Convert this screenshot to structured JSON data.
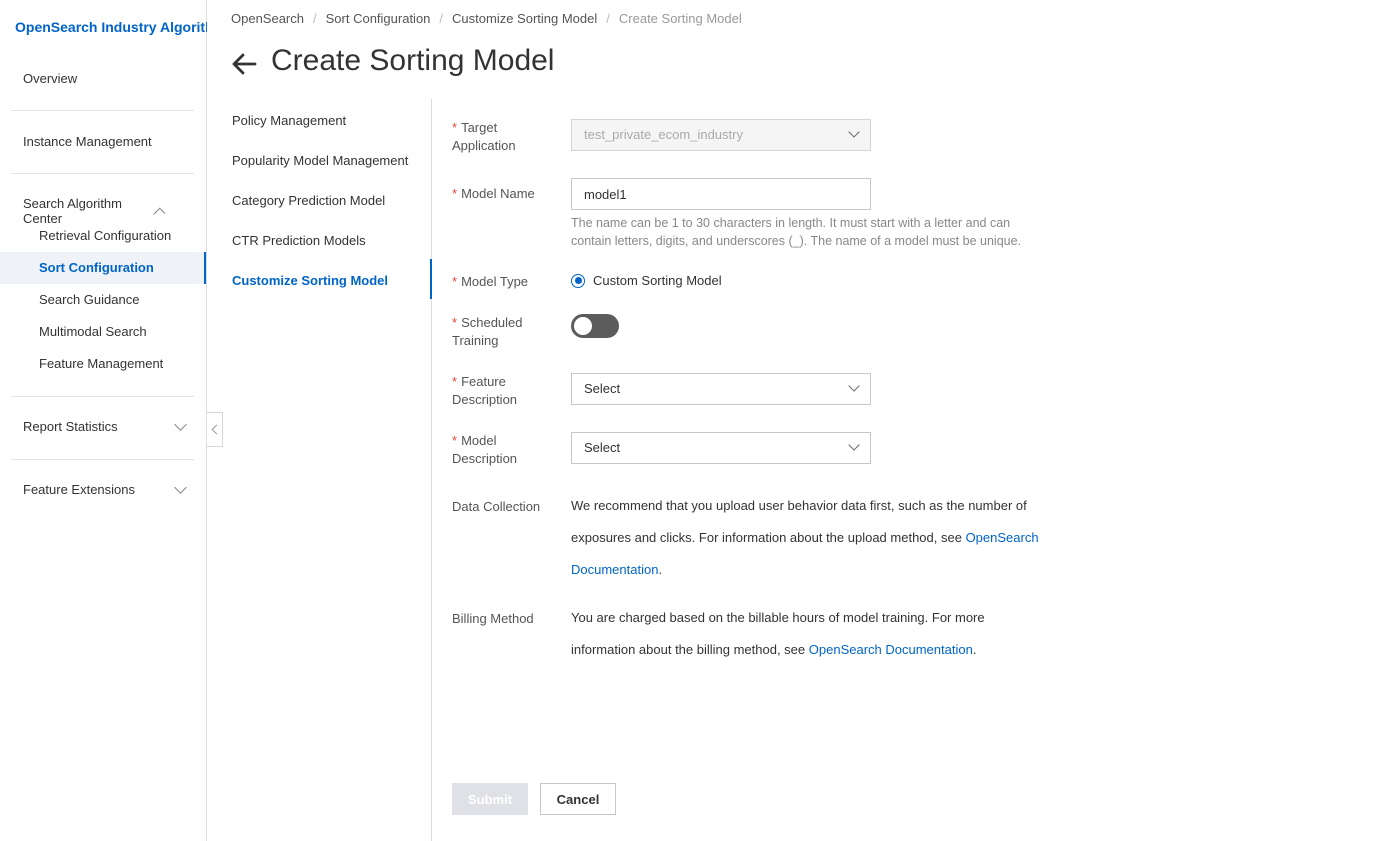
{
  "sidebar": {
    "brand": "OpenSearch Industry Algorithm",
    "overview": "Overview",
    "instance_management": "Instance Management",
    "search_algorithm_center": "Search Algorithm Center",
    "sub_items": [
      {
        "label": "Retrieval Configuration"
      },
      {
        "label": "Sort Configuration"
      },
      {
        "label": "Search Guidance"
      },
      {
        "label": "Multimodal Search"
      },
      {
        "label": "Feature Management"
      }
    ],
    "report_statistics": "Report Statistics",
    "feature_extensions": "Feature Extensions"
  },
  "breadcrumb": [
    "OpenSearch",
    "Sort Configuration",
    "Customize Sorting Model",
    "Create Sorting Model"
  ],
  "page_title": "Create Sorting Model",
  "subnav": [
    "Policy Management",
    "Popularity Model Management",
    "Category Prediction Model",
    "CTR Prediction Models",
    "Customize Sorting Model"
  ],
  "form": {
    "target_application": {
      "label": "Target Application",
      "value": "test_private_ecom_industry"
    },
    "model_name": {
      "label": "Model Name",
      "value": "model1",
      "hint": "The name can be 1 to 30 characters in length. It must start with a letter and can contain letters, digits, and underscores (_). The name of a model must be unique."
    },
    "model_type": {
      "label": "Model Type",
      "option": "Custom Sorting Model"
    },
    "scheduled_training": {
      "label": "Scheduled Training"
    },
    "feature_description": {
      "label": "Feature Description",
      "placeholder": "Select"
    },
    "model_description": {
      "label": "Model Description",
      "placeholder": "Select"
    },
    "data_collection": {
      "label": "Data Collection",
      "text": "We recommend that you upload user behavior data first, such as the number of exposures and clicks. For information about the upload method, see ",
      "link": "OpenSearch Documentation",
      "suffix": "."
    },
    "billing_method": {
      "label": "Billing Method",
      "text": "You are charged based on the billable hours of model training. For more information about the billing method, see ",
      "link": "OpenSearch Documentation",
      "suffix": "."
    }
  },
  "buttons": {
    "submit": "Submit",
    "cancel": "Cancel"
  }
}
